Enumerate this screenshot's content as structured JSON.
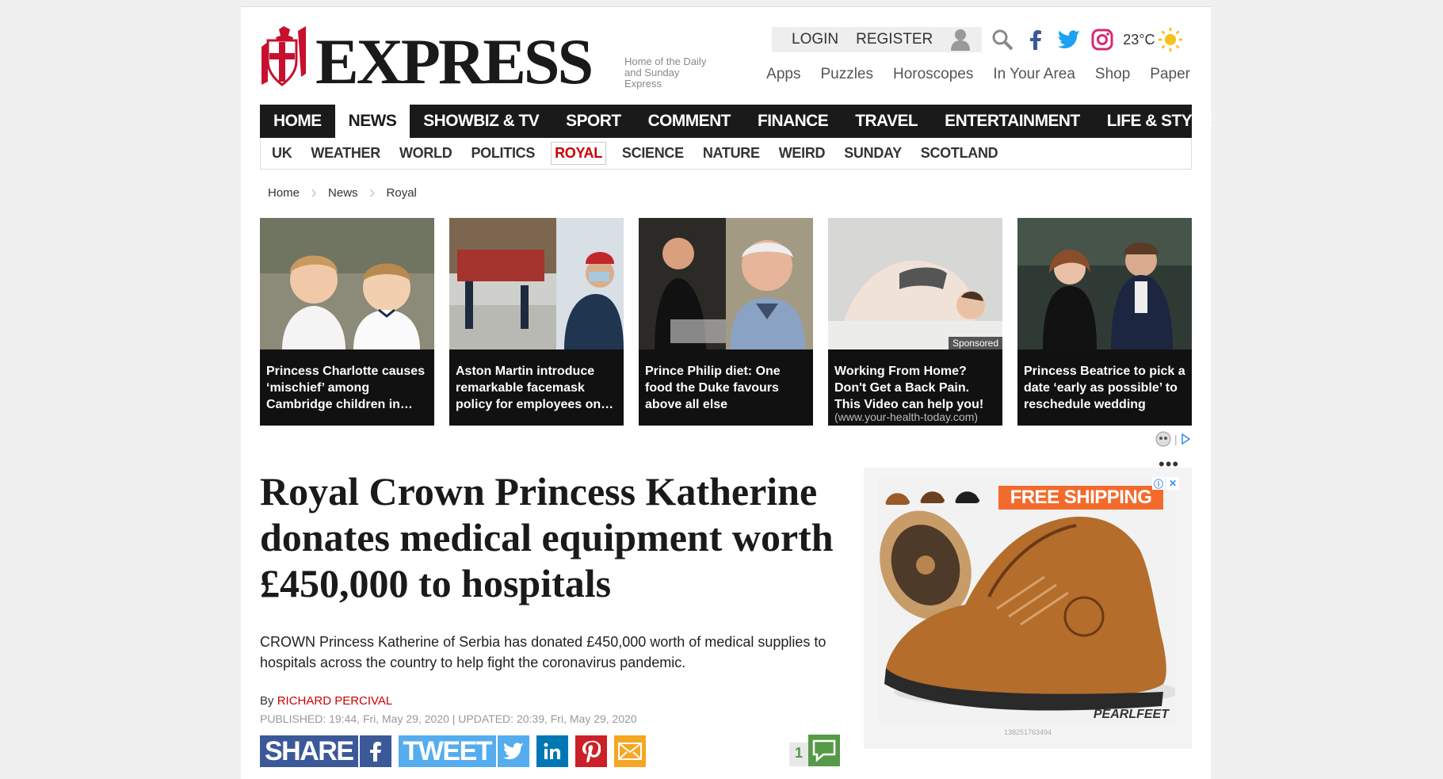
{
  "logo": {
    "wordmark": "EXPRESS",
    "tagline": "Home of the Daily and Sunday Express"
  },
  "topbar": {
    "login": "LOGIN",
    "register": "REGISTER",
    "temperature": "23°C"
  },
  "util_links": [
    "Apps",
    "Puzzles",
    "Horoscopes",
    "In Your Area",
    "Shop",
    "Paper"
  ],
  "main_nav": [
    "HOME",
    "NEWS",
    "SHOWBIZ & TV",
    "SPORT",
    "COMMENT",
    "FINANCE",
    "TRAVEL",
    "ENTERTAINMENT",
    "LIFE & STYLE"
  ],
  "main_nav_active": "NEWS",
  "sub_nav": [
    "UK",
    "WEATHER",
    "WORLD",
    "POLITICS",
    "ROYAL",
    "SCIENCE",
    "NATURE",
    "WEIRD",
    "SUNDAY",
    "SCOTLAND"
  ],
  "sub_nav_active": "ROYAL",
  "breadcrumb": [
    "Home",
    "News",
    "Royal"
  ],
  "cards": [
    {
      "title": "Princess Charlotte causes ‘mischief’ among Cambridge children in…"
    },
    {
      "title": "Aston Martin introduce remarkable facemask policy for employees on…"
    },
    {
      "title": "Prince Philip diet: One food the Duke favours above all else"
    },
    {
      "title": "Working From Home? Don't Get a Back Pain. This Video can help you!",
      "sponsored": "Sponsored",
      "source": "(www.your-health-today.com)"
    },
    {
      "title": "Princess Beatrice to pick a date ‘early as possible’ to reschedule wedding"
    }
  ],
  "article": {
    "headline": "Royal Crown Princess Katherine donates medical equipment worth £450,000 to hospitals",
    "standfirst": "CROWN Princess Katherine of Serbia has donated £450,000 worth of medical supplies to hospitals across the country to help fight the coronavirus pandemic.",
    "by": "By",
    "author": "RICHARD PERCIVAL",
    "dates": "PUBLISHED: 19:44, Fri, May 29, 2020 | UPDATED: 20:39, Fri, May 29, 2020"
  },
  "share": {
    "share_label": "SHARE",
    "tweet_label": "TWEET",
    "comment_count": "1"
  },
  "ad": {
    "banner": "FREE SHIPPING",
    "brand": "PEARLFEET",
    "id": "138251763494"
  },
  "colors": {
    "nav_bg": "#1a1a1a",
    "accent_red": "#c00000",
    "facebook": "#3b5998",
    "twitter": "#55acee",
    "linkedin": "#0077b5",
    "pinterest": "#cb2027",
    "email": "#f5a623"
  }
}
